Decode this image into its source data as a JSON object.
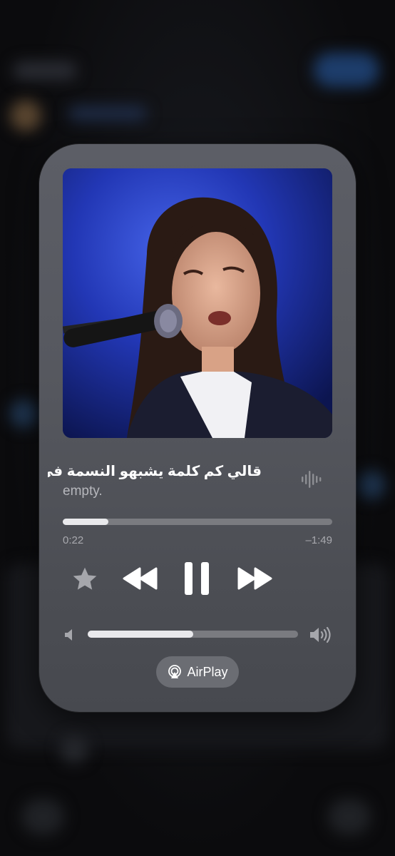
{
  "now_playing": {
    "title": "قالي كم كلمة يشبهو النسمة في",
    "subtitle": "empty.",
    "elapsed": "0:22",
    "remaining": "–1:49",
    "progress": 0.17,
    "volume": 0.5
  },
  "controls": {
    "favorite_icon": "star-icon",
    "rewind_icon": "rewind-icon",
    "pause_icon": "pause-icon",
    "forward_icon": "fast-forward-icon"
  },
  "airplay": {
    "label": "AirPlay"
  },
  "colors": {
    "card": "#56585f",
    "track": "#7a7b80",
    "fill": "#e9e9ec",
    "artwork_bg": "#2236b8"
  }
}
